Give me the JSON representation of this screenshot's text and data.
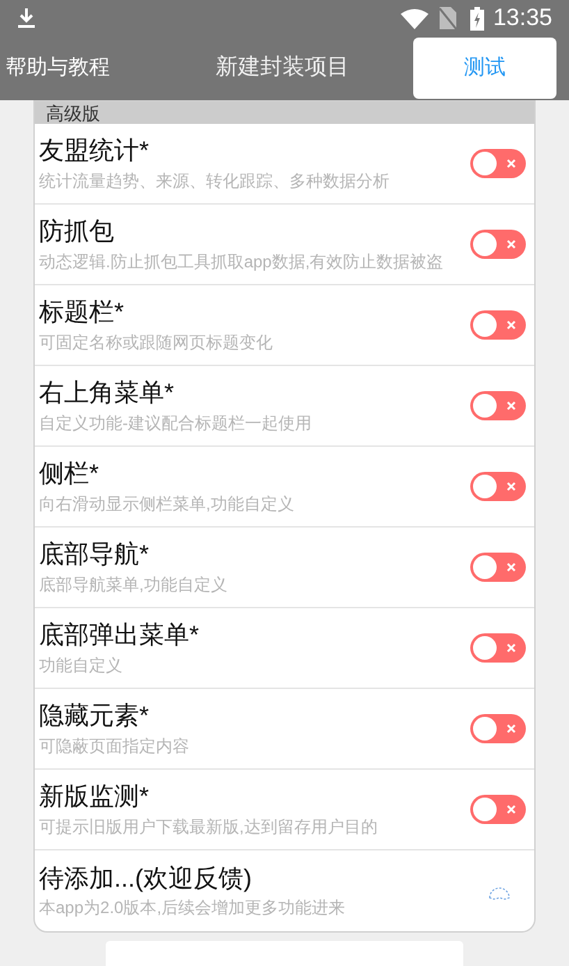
{
  "status_bar": {
    "time": "13:35"
  },
  "header": {
    "left": "帮助与教程",
    "title": "新建封装项目",
    "action": "测试"
  },
  "section": {
    "title": "高级版"
  },
  "features": [
    {
      "title": "友盟统计*",
      "description": "统计流量趋势、来源、转化跟踪、多种数据分析",
      "kind": "toggle",
      "on": false
    },
    {
      "title": "防抓包",
      "description": "动态逻辑.防止抓包工具抓取app数据,有效防止数据被盗",
      "kind": "toggle",
      "on": false
    },
    {
      "title": "标题栏*",
      "description": "可固定名称或跟随网页标题变化",
      "kind": "toggle",
      "on": false
    },
    {
      "title": "右上角菜单*",
      "description": "自定义功能-建议配合标题栏一起使用",
      "kind": "toggle",
      "on": false
    },
    {
      "title": "侧栏*",
      "description": "向右滑动显示侧栏菜单,功能自定义",
      "kind": "toggle",
      "on": false
    },
    {
      "title": "底部导航*",
      "description": "底部导航菜单,功能自定义",
      "kind": "toggle",
      "on": false
    },
    {
      "title": "底部弹出菜单*",
      "description": "功能自定义",
      "kind": "toggle",
      "on": false
    },
    {
      "title": "隐藏元素*",
      "description": "可隐蔽页面指定内容",
      "kind": "toggle",
      "on": false
    },
    {
      "title": "新版监测*",
      "description": "可提示旧版用户下载最新版,达到留存用户目的",
      "kind": "toggle",
      "on": false
    },
    {
      "title": "待添加...(欢迎反馈)",
      "description": "本app为2.0版本,后续会增加更多功能进来",
      "kind": "loading"
    }
  ]
}
